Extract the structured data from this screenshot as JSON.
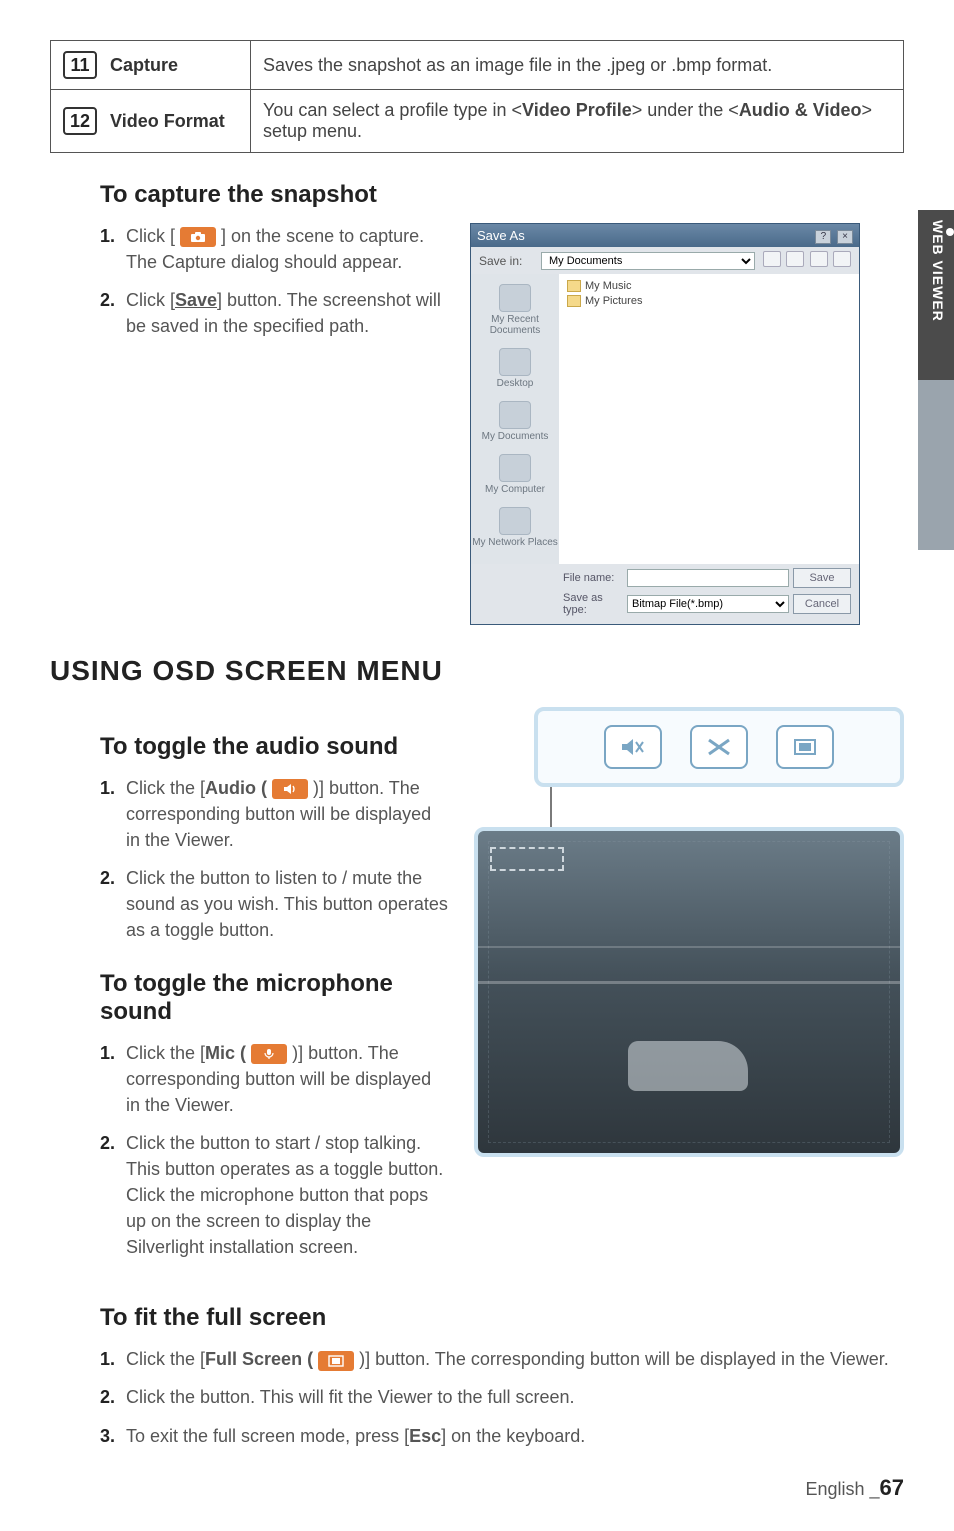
{
  "table": {
    "rows": [
      {
        "num": "11",
        "label": "Capture",
        "desc_pre": "Saves the snapshot as an image file in the .jpeg or .bmp format.",
        "desc_m1": "",
        "desc_mid": "",
        "desc_m2": "",
        "desc_post": ""
      },
      {
        "num": "12",
        "label": "Video Format",
        "desc_pre": "You can select a profile type in <",
        "desc_m1": "Video Profile",
        "desc_mid": "> under the <",
        "desc_m2": "Audio & Video",
        "desc_post": "> setup menu."
      }
    ]
  },
  "sections": {
    "capture_h": "To capture the snapshot",
    "capture_steps": [
      {
        "n": "1.",
        "pre": "Click [ ",
        "post": " ] on the scene to capture. The Capture dialog should appear."
      },
      {
        "n": "2.",
        "pre": "Click [",
        "mid": "Save",
        "post": "] button. The screenshot will be saved in the specified path."
      }
    ],
    "major_h": "USING OSD SCREEN MENU",
    "audio_h": "To toggle the audio sound",
    "audio_steps": [
      {
        "n": "1.",
        "pre": "Click the [",
        "mid": "Audio (",
        "post": ")] button. The corresponding button will be displayed in the Viewer."
      },
      {
        "n": "2.",
        "text": "Click the button to listen to / mute the sound as you wish. This button operates as a toggle button."
      }
    ],
    "mic_h": "To toggle the microphone sound",
    "mic_steps": [
      {
        "n": "1.",
        "pre": "Click the [",
        "mid": "Mic (",
        "post": ")] button. The corresponding button will be displayed in the Viewer."
      },
      {
        "n": "2.",
        "text": "Click the button to start / stop talking. This button operates as a toggle button. Click the microphone button that pops up on the screen to display the Silverlight installation screen."
      }
    ],
    "fit_h": "To fit the full screen",
    "fit_steps": [
      {
        "n": "1.",
        "pre": "Click the [",
        "mid": "Full Screen (",
        "post": ")] button. The corresponding button will be displayed in the Viewer."
      },
      {
        "n": "2.",
        "text": "Click the button. This will fit the Viewer to the full screen."
      },
      {
        "n": "3.",
        "pre": "To exit the full screen mode, press [",
        "mid": "Esc",
        "post": "] on the keyboard."
      }
    ]
  },
  "sidebar": {
    "label": "WEB VIEWER"
  },
  "dialog": {
    "title": "Save As",
    "savein_lbl": "Save in:",
    "savein_val": "My Documents",
    "side": [
      "My Recent Documents",
      "Desktop",
      "My Documents",
      "My Computer",
      "My Network Places"
    ],
    "folders": [
      "My Music",
      "My Pictures"
    ],
    "filename_lbl": "File name:",
    "filename_val": "",
    "type_lbl": "Save as type:",
    "type_val": "Bitmap File(*.bmp)",
    "save_btn": "Save",
    "cancel_btn": "Cancel"
  },
  "footer": {
    "lang": "English",
    "sep": "_",
    "page": "67"
  }
}
